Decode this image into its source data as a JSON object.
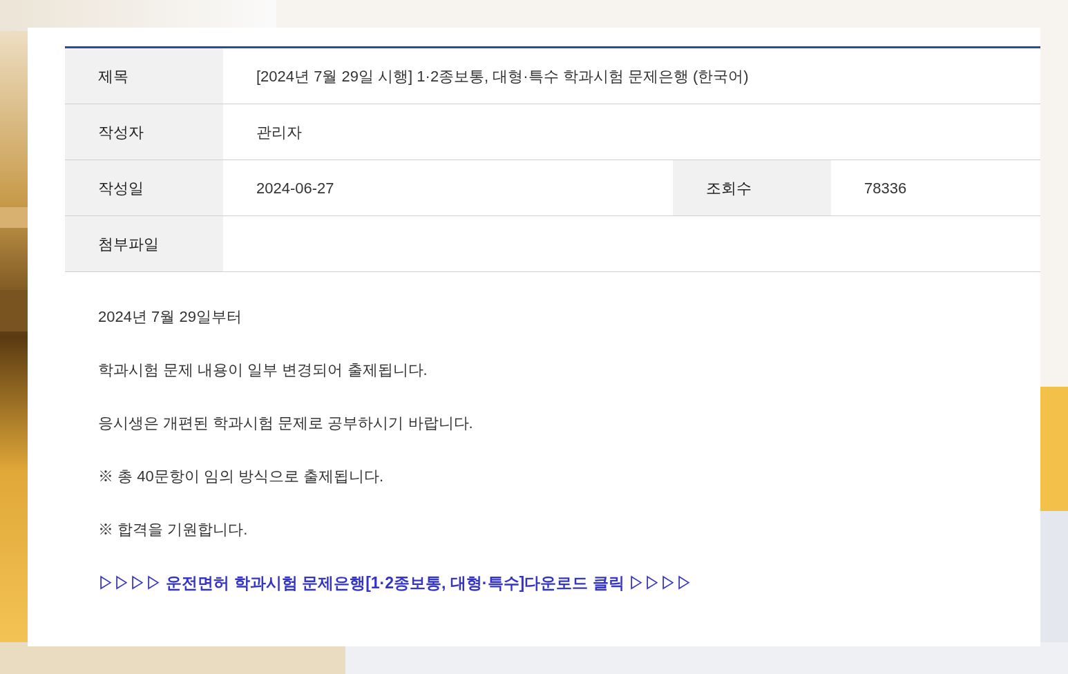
{
  "info_rows": [
    {
      "fields": [
        {
          "label": "제목",
          "value": "[2024년 7월 29일 시행] 1·2종보통, 대형·특수 학과시험 문제은행 (한국어)"
        }
      ]
    },
    {
      "fields": [
        {
          "label": "작성자",
          "value": "관리자"
        }
      ]
    },
    {
      "fields": [
        {
          "label": "작성일",
          "value": "2024-06-27"
        },
        {
          "label": "조회수",
          "value": "78336"
        }
      ]
    },
    {
      "fields": [
        {
          "label": "첨부파일"
        }
      ]
    }
  ],
  "body": [
    {
      "kind": "text",
      "text": "2024년 7월 29일부터"
    },
    {
      "kind": "text",
      "text": "학과시험 문제 내용이 일부 변경되어 출제됩니다."
    },
    {
      "kind": "text",
      "text": "응시생은 개편된 학과시험 문제로 공부하시기 바랍니다."
    },
    {
      "kind": "text",
      "text": "※ 총 40문항이 임의 방식으로 출제됩니다."
    },
    {
      "kind": "text",
      "text": "※ 합격을 기원합니다."
    },
    {
      "kind": "link",
      "text": "▷▷▷▷ 운전면허 학과시험 문제은행[1·2종보통, 대형·특수]다운로드 클릭 ▷▷▷▷"
    }
  ]
}
